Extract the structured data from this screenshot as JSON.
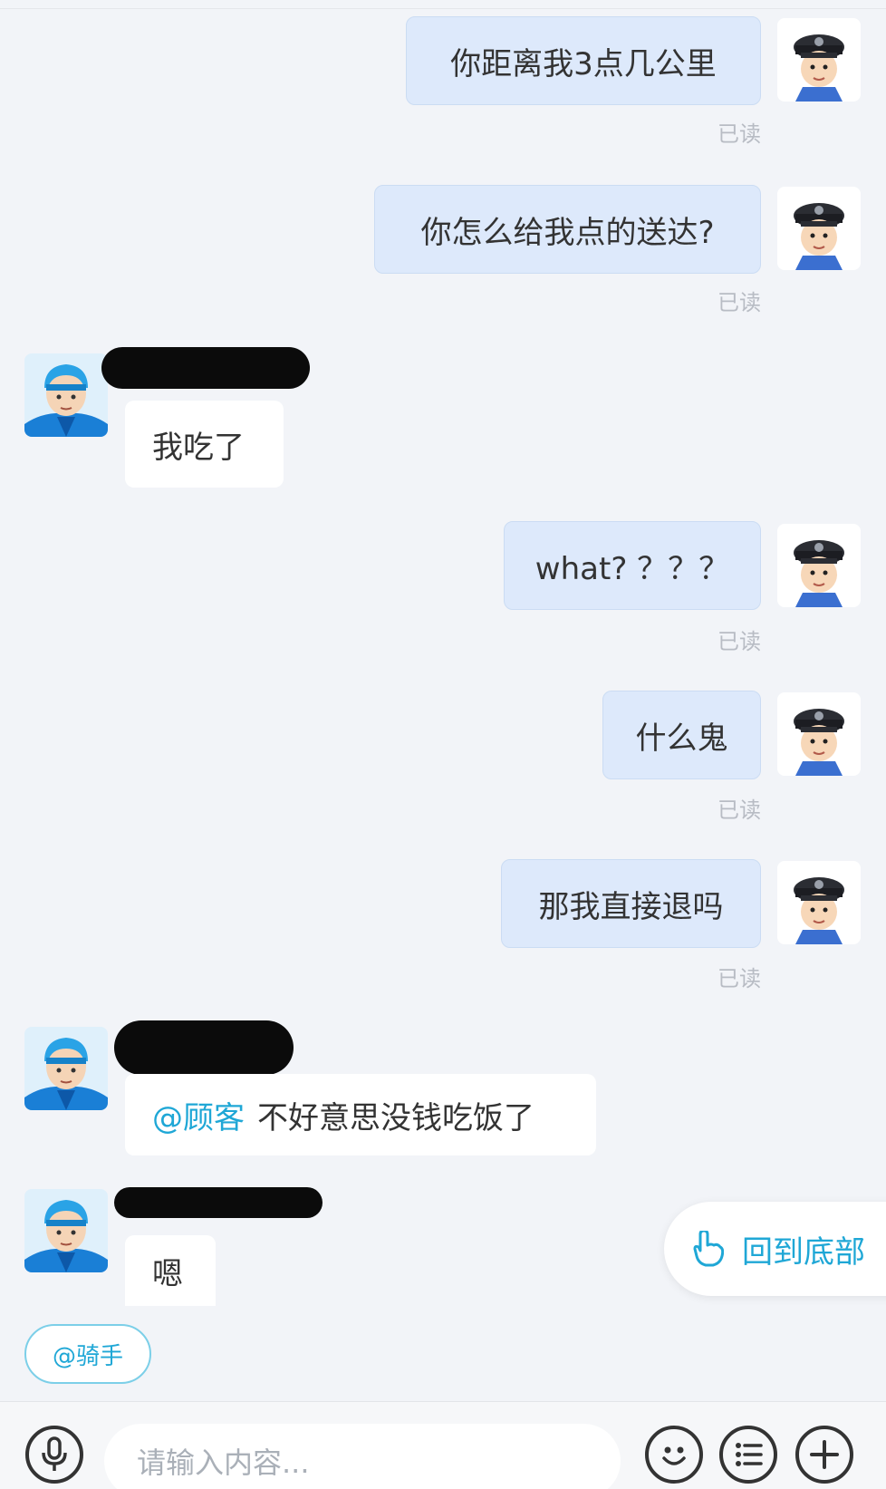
{
  "messages": [
    {
      "side": "out",
      "text": "你距离我3点几公里",
      "status": "已读"
    },
    {
      "side": "out",
      "text": "你怎么给我点的送达?",
      "status": "已读"
    },
    {
      "side": "in",
      "text": "我吃了"
    },
    {
      "side": "out",
      "text": "what? ？？？",
      "status": "已读"
    },
    {
      "side": "out",
      "text": "什么鬼",
      "status": "已读"
    },
    {
      "side": "out",
      "text": "那我直接退吗",
      "status": "已读"
    },
    {
      "side": "in",
      "mention": "@顾客",
      "text": "不好意思没钱吃饭了"
    },
    {
      "side": "in",
      "text": "嗯"
    }
  ],
  "back_to_bottom": "回到底部",
  "at_rider": "@骑手",
  "input": {
    "placeholder": "请输入内容..."
  },
  "icons": [
    "microphone-icon",
    "emoji-icon",
    "list-icon",
    "plus-icon",
    "police-avatar",
    "rider-avatar",
    "pointer-hand-icon"
  ],
  "colors": {
    "accent": "#1fa7d6",
    "outgoing_bubble": "#dde9fb",
    "background": "#f2f4f8"
  }
}
